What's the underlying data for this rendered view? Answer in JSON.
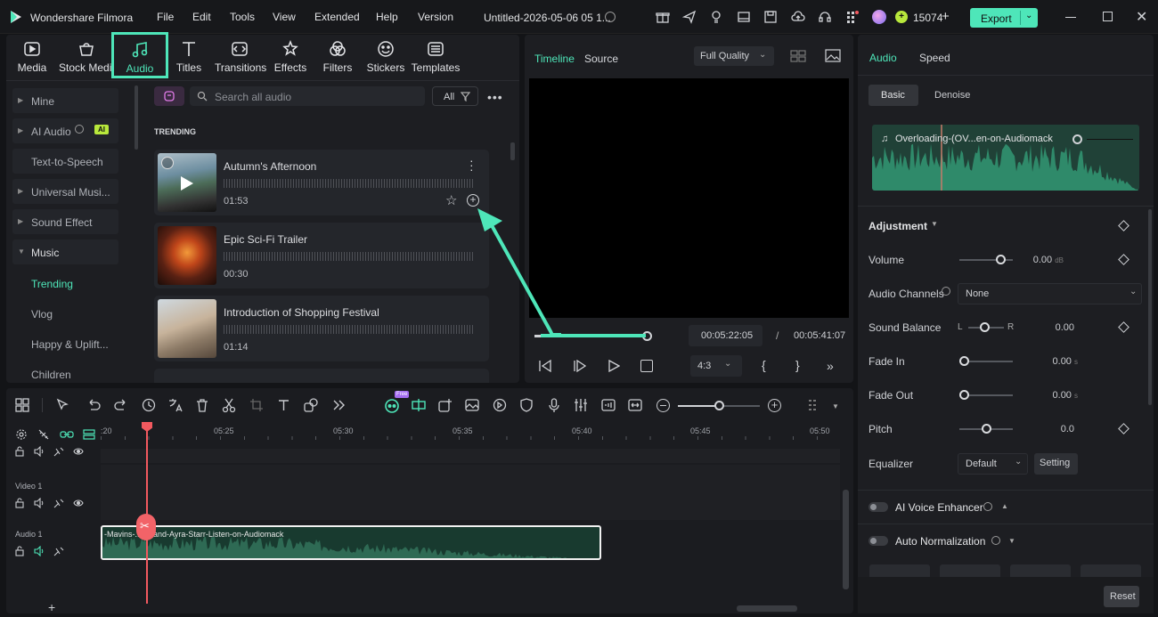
{
  "app": {
    "name": "Wondershare Filmora",
    "project_title": "Untitled-2026-05-06 05 1...",
    "credits": "15074",
    "export_label": "Export"
  },
  "menu": [
    "File",
    "Edit",
    "Tools",
    "View",
    "Extended",
    "Help",
    "Version"
  ],
  "toolbar_tabs": [
    {
      "label": "Media",
      "icon": "media-icon"
    },
    {
      "label": "Stock Medi",
      "icon": "stock-media-icon"
    },
    {
      "label": "Audio",
      "icon": "music-note-icon",
      "active": true
    },
    {
      "label": "Titles",
      "icon": "titles-icon"
    },
    {
      "label": "Transitions",
      "icon": "transitions-icon"
    },
    {
      "label": "Effects",
      "icon": "effects-icon"
    },
    {
      "label": "Filters",
      "icon": "filters-icon"
    },
    {
      "label": "Stickers",
      "icon": "stickers-icon"
    },
    {
      "label": "Templates",
      "icon": "templates-icon"
    }
  ],
  "sidebar": {
    "items": [
      "Mine",
      "AI Audio",
      "Text-to-Speech",
      "Universal Musi...",
      "Sound Effect",
      "Music"
    ],
    "ai_badge": "AI",
    "sub_items": [
      "Trending",
      "Vlog",
      "Happy & Uplift...",
      "Children"
    ]
  },
  "library": {
    "search_placeholder": "Search all audio",
    "filter_label": "All",
    "section_title": "TRENDING",
    "tracks": [
      {
        "title": "Autumn's Afternoon",
        "duration": "01:53"
      },
      {
        "title": "Epic Sci-Fi Trailer",
        "duration": "00:30"
      },
      {
        "title": "Introduction of Shopping Festival",
        "duration": "01:14"
      }
    ]
  },
  "player": {
    "tabs": [
      "Timeline",
      "Source"
    ],
    "quality": "Full Quality",
    "current_time": "00:05:22:05",
    "separator": "/",
    "total_time": "00:05:41:07",
    "aspect": "4:3",
    "progress": 0.98
  },
  "right_panel": {
    "tabs": [
      "Audio",
      "Speed"
    ],
    "sub_tabs": [
      "Basic",
      "Denoise"
    ],
    "clip_name": "Overloading-(OV...en-on-Audiomack",
    "adjustment_label": "Adjustment",
    "volume": {
      "label": "Volume",
      "value": "0.00",
      "unit": "dB"
    },
    "audio_channels": {
      "label": "Audio Channels",
      "value": "None"
    },
    "sound_balance": {
      "label": "Sound Balance",
      "left": "L",
      "right": "R",
      "value": "0.00"
    },
    "fade_in": {
      "label": "Fade In",
      "value": "0.00",
      "unit": "s"
    },
    "fade_out": {
      "label": "Fade Out",
      "value": "0.00",
      "unit": "s"
    },
    "pitch": {
      "label": "Pitch",
      "value": "0.0"
    },
    "equalizer": {
      "label": "Equalizer",
      "value": "Default",
      "setting": "Setting"
    },
    "ai_voice": "AI Voice Enhancer",
    "auto_norm": "Auto Normalization",
    "reset": "Reset"
  },
  "timeline": {
    "ruler": [
      ":20",
      "05:25",
      "05:30",
      "05:35",
      "05:40",
      "05:45",
      "05:50"
    ],
    "tracks": {
      "video": "Video 1",
      "audio": "Audio 1"
    },
    "audio_clip": "-Mavins-...on-and-Ayra-Starr-Listen-on-Audiomack",
    "free_badge": "Free",
    "add": "+"
  },
  "colors": {
    "accent": "#4ee6b9",
    "playhead": "#f2595f",
    "wave": "#2f6b55"
  }
}
